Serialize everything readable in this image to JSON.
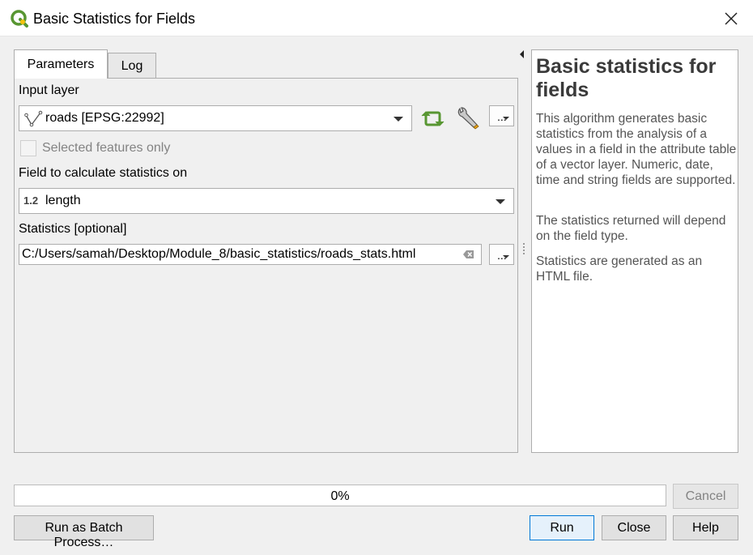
{
  "window": {
    "title": "Basic Statistics for Fields",
    "app_icon": "qgis-logo-icon",
    "close_icon": "close-icon"
  },
  "tabs": [
    {
      "label": "Parameters",
      "active": true
    },
    {
      "label": "Log",
      "active": false
    }
  ],
  "parameters": {
    "input_layer_label": "Input layer",
    "input_layer_value": "roads [EPSG:22992]",
    "input_layer_icon": "line-layer-icon",
    "iterate_icon": "iterate-icon",
    "settings_icon": "wrench-icon",
    "dots_label": "...",
    "selected_only_label": "Selected features only",
    "selected_only_checked": false,
    "field_label": "Field to calculate statistics on",
    "field_type_badge": "1.2",
    "field_value": "length",
    "stats_label": "Statistics [optional]",
    "stats_value": "C:/Users/samah/Desktop/Module_8/basic_statistics/roads_stats.html",
    "clear_icon": "clear-text-icon"
  },
  "help": {
    "title": "Basic statistics for fields",
    "paragraphs": [
      "This algorithm generates basic statistics from the analysis of a values in a field in the attribute table of a vector layer. Numeric, date, time and string fields are supported.",
      "The statistics returned will depend on the field type.",
      "Statistics are generated as an HTML file."
    ]
  },
  "progress": {
    "value": 0,
    "text": "0%"
  },
  "buttons": {
    "cancel": "Cancel",
    "batch": "Run as Batch Process…",
    "run": "Run",
    "close": "Close",
    "help": "Help"
  },
  "colors": {
    "accent": "#0078d7",
    "qgis_green": "#589632",
    "qgis_yellow": "#ee7913"
  }
}
